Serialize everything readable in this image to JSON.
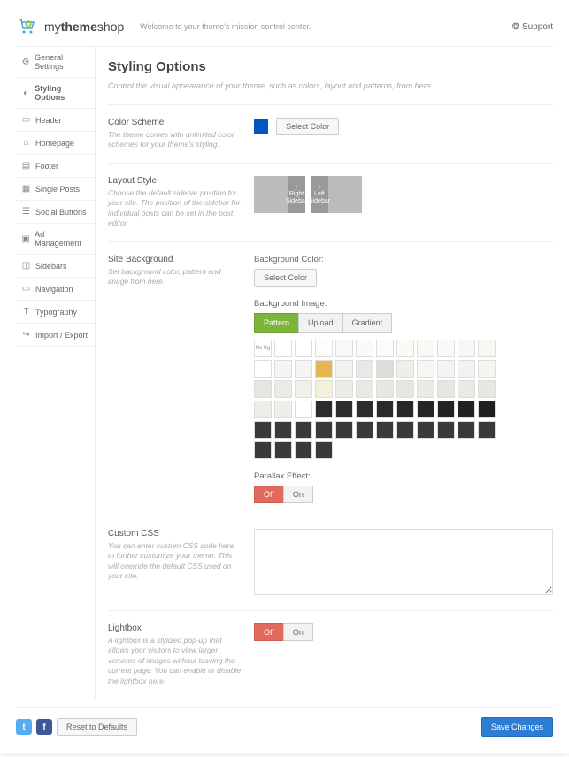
{
  "brand": {
    "prefix": "my",
    "bold": "theme",
    "suffix": "shop"
  },
  "welcome": "Welcome to your theme's mission control center.",
  "support": "Support",
  "nav": [
    {
      "label": "General Settings",
      "icon": "⚙"
    },
    {
      "label": "Styling Options",
      "icon": "◐",
      "active": true
    },
    {
      "label": "Header",
      "icon": "▭"
    },
    {
      "label": "Homepage",
      "icon": "⌂"
    },
    {
      "label": "Footer",
      "icon": "▤"
    },
    {
      "label": "Single Posts",
      "icon": "▦"
    },
    {
      "label": "Social Buttons",
      "icon": "☰"
    },
    {
      "label": "Ad Management",
      "icon": "▣"
    },
    {
      "label": "Sidebars",
      "icon": "◫"
    },
    {
      "label": "Navigation",
      "icon": "▭"
    },
    {
      "label": "Typography",
      "icon": "T"
    },
    {
      "label": "Import / Export",
      "icon": "↪"
    }
  ],
  "page": {
    "title": "Styling Options",
    "desc": "Control the visual appearance of your theme, such as colors, layout and patterns, from here."
  },
  "color_scheme": {
    "title": "Color Scheme",
    "desc": "The theme comes with unlimited color schemes for your theme's styling.",
    "button": "Select Color",
    "value": "#0059c1"
  },
  "layout_style": {
    "title": "Layout Style",
    "desc": "Choose the default sidebar position for your site. The position of the sidebar for individual posts can be set in the post editor.",
    "options": [
      {
        "label": "Right Sidebar",
        "side": "right"
      },
      {
        "label": "Left Sidebar",
        "side": "left"
      }
    ]
  },
  "site_background": {
    "title": "Site Background",
    "desc": "Set background color, pattern and image from here.",
    "bgcolor_label": "Background Color:",
    "bgcolor_button": "Select Color",
    "bgimage_label": "Background Image:",
    "tabs": [
      "Pattern",
      "Upload",
      "Gradient"
    ],
    "active_tab": "Pattern",
    "nobg_label": "No Bg",
    "pattern_colors": [
      "#ffffff",
      "#ffffff",
      "#fdfdfa",
      "#f8f8f6",
      "#fafafa",
      "#fbfbfb",
      "#fafaf7",
      "#f8f8f5",
      "#f9f9f7",
      "#f7f7f4",
      "#f8f7f3",
      "#ffffff",
      "#f6f5f1",
      "#f6f5f1",
      "#e8b651",
      "#f2f1ed",
      "#e9e8e4",
      "#dedcd7",
      "#efeee9",
      "#f7f6f2",
      "#f5f4f0",
      "#f3f2ee",
      "#f6f5f1",
      "#e6e5e0",
      "#eceae5",
      "#f0efea",
      "#f3f1d7",
      "#ecebe6",
      "#e9e8e3",
      "#e8e7e2",
      "#e6e5e0",
      "#eae9e4",
      "#e7e6e1",
      "#eae9e4",
      "#e8e7e2",
      "#eeedea",
      "#efeeeb",
      "#ffffff",
      "#2c2c2c",
      "#2c2c2c",
      "#2c2c2c",
      "#2a2a2a",
      "#282828",
      "#262626",
      "#242424",
      "#222222",
      "#202020",
      "#3a3a3a",
      "#3a3a3a",
      "#3a3a3a",
      "#3a3a3a",
      "#3a3a3a",
      "#3a3a3a",
      "#3a3a3a",
      "#3a3a3a",
      "#3a3a3a",
      "#3a3a3a",
      "#3a3a3a",
      "#3a3a3a",
      "#3a3a3a",
      "#3a3a3a",
      "#3a3a3a",
      "#3a3a3a"
    ],
    "parallax_label": "Parallax Effect:",
    "parallax_options": [
      "Off",
      "On"
    ],
    "parallax_value": "Off"
  },
  "custom_css": {
    "title": "Custom CSS",
    "desc": "You can enter custom CSS code here to further customize your theme. This will override the default CSS used on your site.",
    "value": ""
  },
  "lightbox": {
    "title": "Lightbox",
    "desc": "A lightbox is a stylized pop-up that allows your visitors to view larger versions of images without leaving the current page. You can enable or disable the lightbox here.",
    "options": [
      "Off",
      "On"
    ],
    "value": "Off"
  },
  "footer": {
    "reset": "Reset to Defaults",
    "save": "Save Changes"
  }
}
